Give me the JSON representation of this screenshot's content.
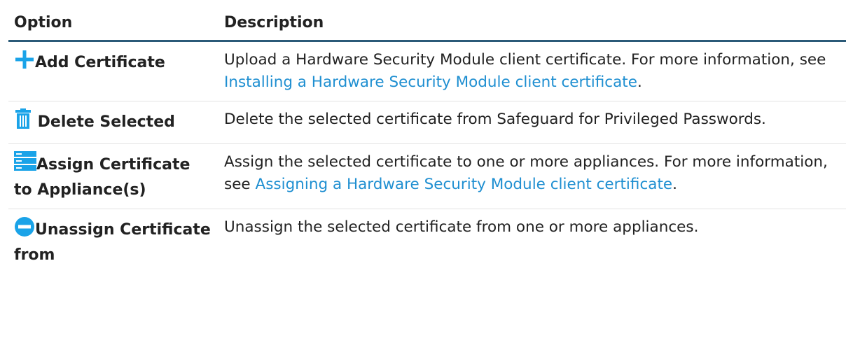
{
  "table": {
    "header": {
      "option": "Option",
      "description": "Description"
    },
    "rows": [
      {
        "icon": "plus-icon",
        "option": "Add Certificate",
        "desc_before": "Upload a Hardware Security Module client certificate. For more information, see ",
        "link": "Installing a Hardware Security Module client certificate",
        "desc_after": "."
      },
      {
        "icon": "trash-icon",
        "option": "Delete Selected",
        "desc_before": "Delete the selected certificate from Safeguard for Privileged Passwords.",
        "link": "",
        "desc_after": ""
      },
      {
        "icon": "server-icon",
        "option": "Assign Certificate to Appliance(s)",
        "desc_before": "Assign the selected certificate to one or more appliances. For more information, see ",
        "link": "Assigning a Hardware Security Module client certificate",
        "desc_after": "."
      },
      {
        "icon": "minus-circle-icon",
        "option": "Unassign Certificate from",
        "desc_before": "Unassign the selected certificate from one or more appliances.",
        "link": "",
        "desc_after": ""
      }
    ]
  },
  "colors": {
    "icon": "#1aa3e8",
    "link": "#1f8fd1",
    "header_rule": "#2b5a78"
  }
}
